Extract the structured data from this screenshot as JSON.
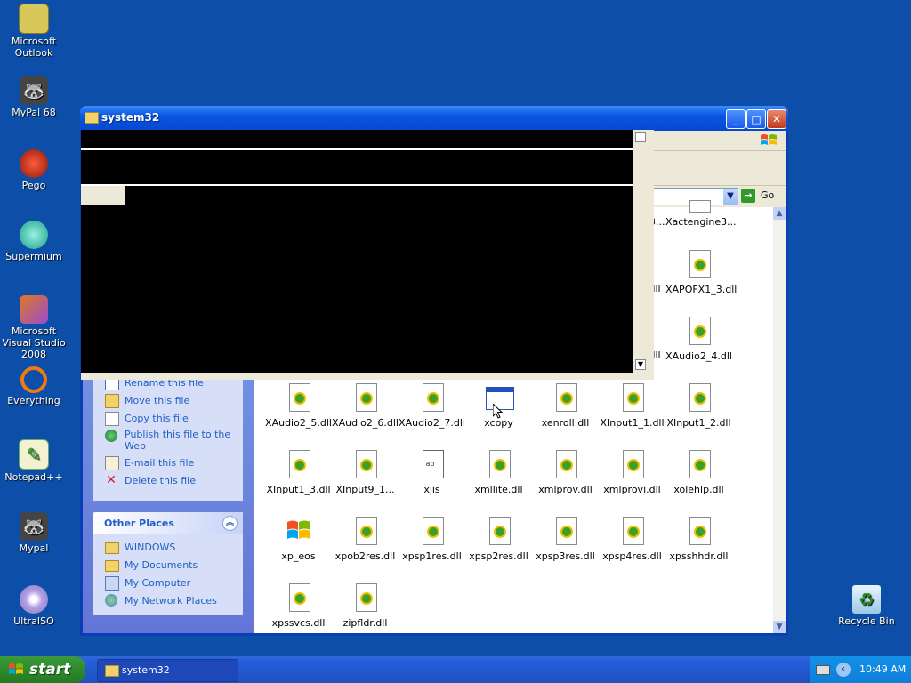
{
  "desktop": {
    "icons": [
      {
        "label": "Microsoft Outlook",
        "icon": "outlook-icon"
      },
      {
        "label": "MyPal 68",
        "icon": "raccoon-icon"
      },
      {
        "label": "Pego",
        "icon": "pego-icon"
      },
      {
        "label": "Supermium",
        "icon": "supermium-icon"
      },
      {
        "label": "Microsoft Visual Studio 2008",
        "icon": "visual-studio-icon"
      },
      {
        "label": "Everything",
        "icon": "everything-icon"
      },
      {
        "label": "Notepad++",
        "icon": "notepad-plus-plus-icon"
      },
      {
        "label": "Mypal",
        "icon": "raccoon-icon"
      },
      {
        "label": "UltraISO",
        "icon": "disc-icon"
      },
      {
        "label": "Recycle Bin",
        "icon": "recycle-bin-icon"
      }
    ]
  },
  "window": {
    "title": "system32",
    "address": {
      "go_label": "Go"
    },
    "colors": {
      "title_blue": "#0a55e0",
      "pane_blue": "#6375d6",
      "link_blue": "#215dc6"
    }
  },
  "task_pane": {
    "file_tasks": [
      {
        "label": "Rename this file",
        "icon": "rename-icon"
      },
      {
        "label": "Move this file",
        "icon": "move-icon"
      },
      {
        "label": "Copy this file",
        "icon": "copy-icon"
      },
      {
        "label": "Publish this file to the Web",
        "icon": "globe-icon"
      },
      {
        "label": "E-mail this file",
        "icon": "email-icon"
      },
      {
        "label": "Delete this file",
        "icon": "delete-icon"
      }
    ],
    "other_places": {
      "title": "Other Places",
      "items": [
        {
          "label": "WINDOWS",
          "icon": "folder-icon"
        },
        {
          "label": "My Documents",
          "icon": "folder-icon"
        },
        {
          "label": "My Computer",
          "icon": "computer-icon"
        },
        {
          "label": "My Network Places",
          "icon": "network-icon"
        }
      ]
    }
  },
  "files": {
    "partial_top": [
      "3...",
      "Xactengine3...",
      ".dll",
      "XAPOFX1_3.dll",
      ".dll",
      "XAudio2_4.dll"
    ],
    "row1": [
      "XAudio2_5.dll",
      "XAudio2_6.dll",
      "XAudio2_7.dll",
      "xcopy",
      "xenroll.dll",
      "XInput1_1.dll",
      "XInput1_2.dll"
    ],
    "row2": [
      "XInput1_3.dll",
      "XInput9_1...",
      "xjis",
      "xmllite.dll",
      "xmlprov.dll",
      "xmlprovi.dll",
      "xolehlp.dll"
    ],
    "row3": [
      "xp_eos",
      "xpob2res.dll",
      "xpsp1res.dll",
      "xpsp2res.dll",
      "xpsp3res.dll",
      "xpsp4res.dll",
      "xpsshhdr.dll"
    ],
    "row4": [
      "xpssvcs.dll",
      "zipfldr.dll"
    ]
  },
  "taskbar": {
    "start_label": "start",
    "task_item": "system32",
    "clock": "10:49 AM"
  }
}
